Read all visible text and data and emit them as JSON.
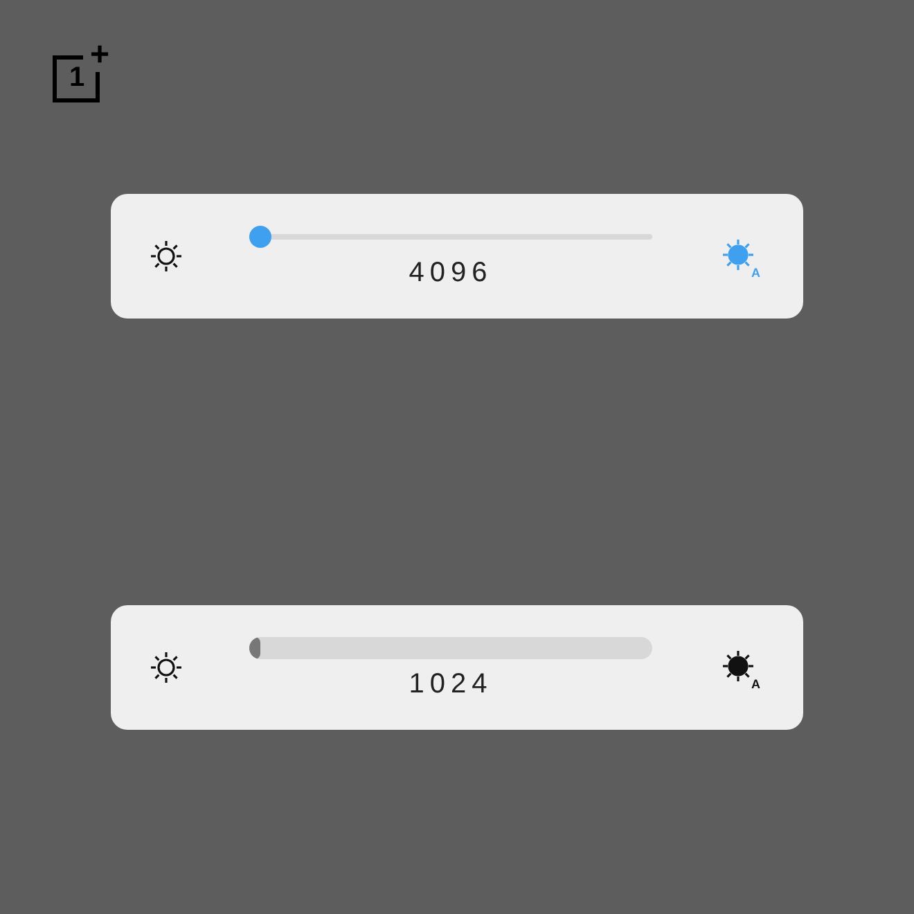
{
  "logo": {
    "digit": "1",
    "mark": "+"
  },
  "brightness_panels": [
    {
      "kind": "thin",
      "level": 0,
      "value": "4096",
      "auto": {
        "on": true,
        "label": "A"
      }
    },
    {
      "kind": "thick",
      "level": 0,
      "value": "1024",
      "auto": {
        "on": false,
        "label": "A"
      }
    }
  ]
}
